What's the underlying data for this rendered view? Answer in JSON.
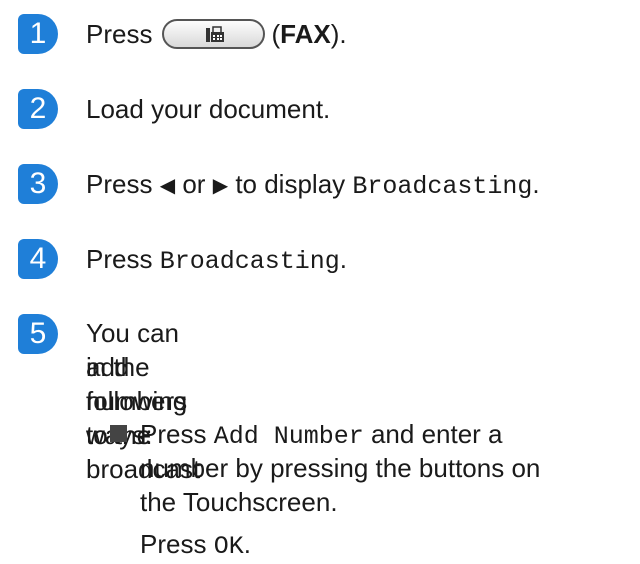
{
  "steps": [
    {
      "number": "1",
      "press": "Press",
      "fax_open": "(",
      "fax_label": "FAX",
      "fax_close": ")."
    },
    {
      "number": "2",
      "text": "Load your document."
    },
    {
      "number": "3",
      "press": "Press",
      "left": "◀",
      "or": "or",
      "right": "▶",
      "to_display": "to display",
      "mono": "Broadcasting",
      "end": "."
    },
    {
      "number": "4",
      "press": "Press",
      "mono": "Broadcasting",
      "end": "."
    },
    {
      "number": "5",
      "line1": "You can add numbers to the broadcast",
      "line2": "in the following ways:"
    }
  ],
  "bullet": {
    "press": "Press",
    "mono": "Add Number",
    "after": "and enter a",
    "line2": "number by pressing the buttons on",
    "line3": "the Touchscreen.",
    "press_ok": "Press",
    "ok": "OK",
    "ok_end": "."
  },
  "colors": {
    "step_badge": "#1f7fd8"
  },
  "icons": {
    "fax_button": "fax-icon"
  }
}
